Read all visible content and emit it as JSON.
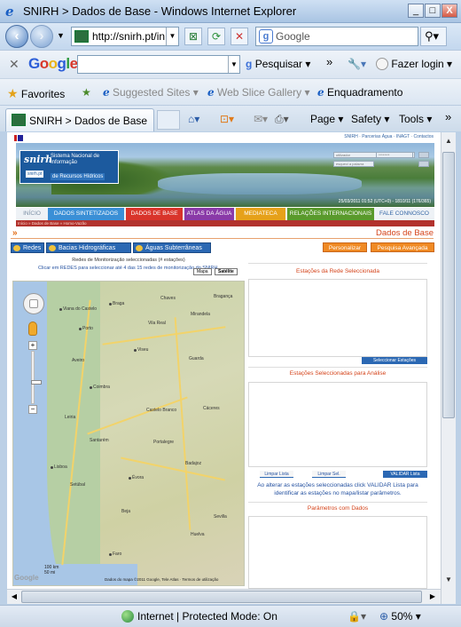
{
  "window": {
    "title": "SNIRH > Dados de Base - Windows Internet Explorer",
    "minimize": "_",
    "maximize": "□",
    "close": "X"
  },
  "nav": {
    "url": "http://snirh.pt/in",
    "search_placeholder": "Google"
  },
  "googlebar": {
    "pesquisar": "Pesquisar",
    "fazer_login": "Fazer login",
    "more": "»"
  },
  "favorites": {
    "label": "Favorites",
    "items": [
      "Suggested Sites",
      "Web Slice Gallery",
      "Enquadramento"
    ]
  },
  "tab": {
    "title": "SNIRH > Dados de Base"
  },
  "commands": [
    "Page",
    "Safety",
    "Tools"
  ],
  "site": {
    "toplinks": "SNIRH · Parcerias Água · INAGT · Contactos",
    "logo_short": "snirh",
    "logo_badge": "snirh.pt",
    "logo_title": "Sistema Nacional de Informação",
    "logo_sub": "de Recursos Hídricos",
    "login_user": "utilizador",
    "login_pass": "********",
    "login_forgot": "esqueci a palavra",
    "banner_date": "25/03/2011 01:52 (UTC+0) - 1810/11 (176/365)",
    "menu": [
      {
        "label": "INÍCIO",
        "color": "#eef2f6",
        "text": "#7a8ea4"
      },
      {
        "label": "DADOS SINTETIZADOS",
        "color": "#3a8fd6",
        "text": "#ffffff"
      },
      {
        "label": "DADOS DE BASE",
        "color": "#d9342b",
        "text": "#ffffff"
      },
      {
        "label": "ATLAS DA ÁGUA",
        "color": "#8a3aa8",
        "text": "#ffffff"
      },
      {
        "label": "MEDIATECA",
        "color": "#e6a11a",
        "text": "#ffffff"
      },
      {
        "label": "RELAÇÕES INTERNACIONAIS",
        "color": "#5a9a2c",
        "text": "#ffffff"
      },
      {
        "label": "FALE CONNOSCO",
        "color": "#eef2f6",
        "text": "#3465a4"
      }
    ],
    "breadcrumb": "Início » Dados de Base » Homo-Vazão",
    "section_title": "Dados de Base",
    "buttons": [
      "Redes",
      "Bacias Hidrográficas",
      "Águas Subterrâneas"
    ],
    "personalizar": "Personalizar",
    "pesquisa_avancada": "Pesquisa Avançada",
    "redes_title": "Redes de Monitorização seleccionadas (# estações)",
    "redes_sub": "Clicar em REDES para seleccionar até 4 das 15 redes de monitorização do SNIRH.",
    "map_type_map": "Mapa",
    "map_type_sat": "Satélite",
    "scale_km": "100 km",
    "scale_mi": "50 mi",
    "map_legal": "Dados do mapa ©2011 Google, Tele Atlas · Termos de utilização",
    "map_logo": "Google",
    "cities": [
      "Viana do Castelo",
      "Braga",
      "Chaves",
      "Bragança",
      "Vila Real",
      "Porto",
      "Mirandela",
      "Aveiro",
      "Viseu",
      "Guarda",
      "Coimbra",
      "Leiria",
      "Castelo Branco",
      "Santarém",
      "Portalegre",
      "Lisboa",
      "Setúbal",
      "Évora",
      "Badajoz",
      "Beja",
      "Huelva",
      "Faro",
      "Sevilla",
      "Cáceres"
    ],
    "panel_rede_title": "Estações da Rede Seleccionada",
    "btn_seleccionar": "Seleccionar Estações",
    "panel_analise_title": "Estações Seleccionadas para Análise",
    "btn_limpar_lista": "Limpar Lista",
    "btn_limpar_sel": "Limpar Sel.",
    "btn_validar": "VALIDAR Lista",
    "note": "Ao alterar as estações seleccionadas click VALIDAR Lista para identificar as estações no mapa/listar parâmetros.",
    "panel_param_title": "Parâmetros com Dados"
  },
  "status": {
    "zone": "Internet | Protected Mode: On",
    "zoom": "50%"
  }
}
